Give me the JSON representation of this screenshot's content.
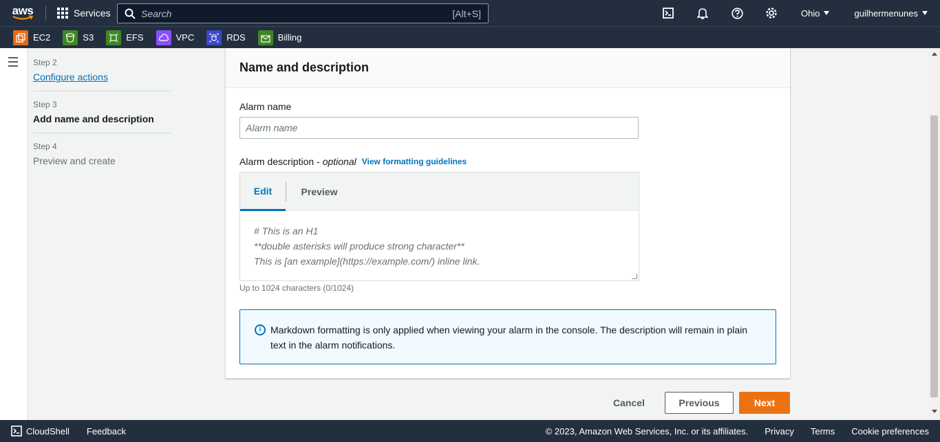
{
  "topbar": {
    "logo": "aws",
    "services": "Services",
    "search_placeholder": "Search",
    "search_shortcut": "[Alt+S]",
    "region": "Ohio",
    "user": "guilhermenunes"
  },
  "favorites": [
    {
      "label": "EC2",
      "color": "#e36b18"
    },
    {
      "label": "S3",
      "color": "#3f8624"
    },
    {
      "label": "EFS",
      "color": "#3f8624"
    },
    {
      "label": "VPC",
      "color": "#8c4fff"
    },
    {
      "label": "RDS",
      "color": "#3b48cc"
    },
    {
      "label": "Billing",
      "color": "#3f8624"
    }
  ],
  "steps": [
    {
      "num": "Step 2",
      "label": "Configure actions"
    },
    {
      "num": "Step 3",
      "label": "Add name and description"
    },
    {
      "num": "Step 4",
      "label": "Preview and create"
    }
  ],
  "panel": {
    "title": "Name and description",
    "alarm_name_label": "Alarm name",
    "alarm_name_placeholder": "Alarm name",
    "desc_label": "Alarm description -",
    "desc_optional": "optional",
    "guidelines_link": "View formatting guidelines",
    "tab_edit": "Edit",
    "tab_preview": "Preview",
    "placeholder_lines": [
      "# This is an H1",
      "**double asterisks will produce strong character**",
      "This is [an example](https://example.com/) inline link."
    ],
    "char_hint": "Up to 1024 characters (0/1024)",
    "info_text": "Markdown formatting is only applied when viewing your alarm in the console. The description will remain in plain text in the alarm notifications."
  },
  "actions": {
    "cancel": "Cancel",
    "previous": "Previous",
    "next": "Next"
  },
  "footer": {
    "cloudshell": "CloudShell",
    "feedback": "Feedback",
    "copyright": "© 2023, Amazon Web Services, Inc. or its affiliates.",
    "privacy": "Privacy",
    "terms": "Terms",
    "cookies": "Cookie preferences"
  },
  "colors": {
    "nav_bg": "#232f3e",
    "link": "#0073bb",
    "primary_button": "#ec7211"
  }
}
